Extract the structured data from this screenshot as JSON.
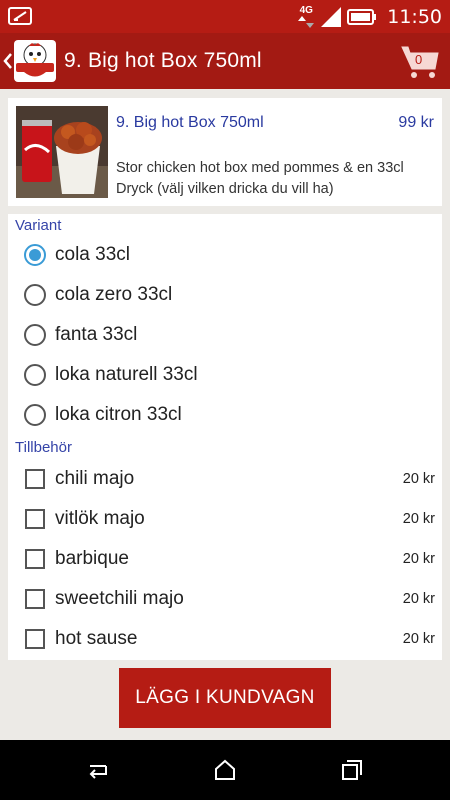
{
  "status_bar": {
    "network": "4G",
    "time": "11:50"
  },
  "header": {
    "title": "9. Big hot Box 750ml",
    "cart_count": "0",
    "logo_text": "CHICKEN"
  },
  "product": {
    "name": "9. Big hot Box 750ml",
    "price": "99 kr",
    "description": "Stor chicken hot box med pommes & en 33cl Dryck (välj vilken dricka du vill ha)"
  },
  "variant_section": {
    "label": "Variant",
    "options": [
      {
        "label": "cola 33cl",
        "selected": true
      },
      {
        "label": "cola zero 33cl",
        "selected": false
      },
      {
        "label": "fanta 33cl",
        "selected": false
      },
      {
        "label": "loka naturell 33cl",
        "selected": false
      },
      {
        "label": "loka citron 33cl",
        "selected": false
      }
    ]
  },
  "extras_section": {
    "label": "Tillbehör",
    "items": [
      {
        "label": "chili majo",
        "price": "20 kr",
        "checked": false
      },
      {
        "label": "vitlök majo",
        "price": "20 kr",
        "checked": false
      },
      {
        "label": "barbique",
        "price": "20 kr",
        "checked": false
      },
      {
        "label": "sweetchili majo",
        "price": "20 kr",
        "checked": false
      },
      {
        "label": "hot sause",
        "price": "20 kr",
        "checked": false
      }
    ]
  },
  "actions": {
    "add_to_cart": "LÄGG I KUNDVAGN"
  },
  "colors": {
    "brand_red": "#a31a13",
    "link_blue": "#2a3aa0",
    "radio_selected": "#3a9bd6"
  }
}
